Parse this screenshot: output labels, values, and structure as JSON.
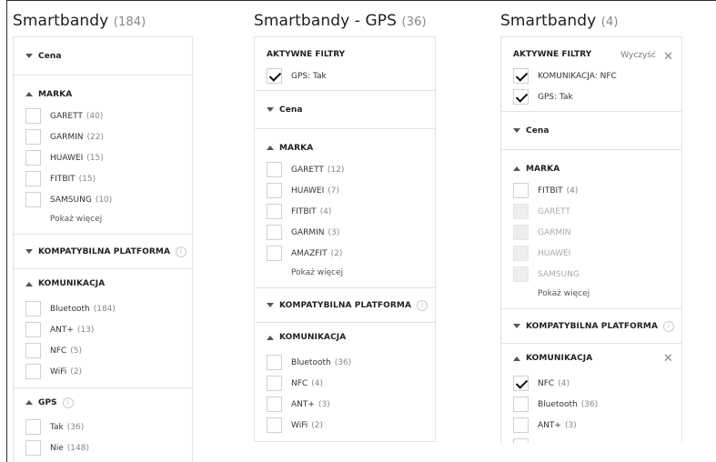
{
  "columns": [
    {
      "title": "Smartbandy",
      "count": "(184)",
      "sections": [
        {
          "label": "Cena",
          "expanded": false
        },
        {
          "label": "MARKA",
          "expanded": true,
          "options": [
            {
              "label": "GARETT",
              "count": "(40)"
            },
            {
              "label": "GARMIN",
              "count": "(22)"
            },
            {
              "label": "HUAWEI",
              "count": "(15)"
            },
            {
              "label": "FITBIT",
              "count": "(15)"
            },
            {
              "label": "SAMSUNG",
              "count": "(10)"
            }
          ],
          "more": "Pokaż więcej"
        },
        {
          "label": "KOMPATYBILNA PLATFORMA",
          "expanded": false,
          "info": true
        },
        {
          "label": "KOMUNIKACJA",
          "expanded": true,
          "options": [
            {
              "label": "Bluetooth",
              "count": "(184)"
            },
            {
              "label": "ANT+",
              "count": "(13)"
            },
            {
              "label": "NFC",
              "count": "(5)"
            },
            {
              "label": "WiFi",
              "count": "(2)"
            }
          ]
        },
        {
          "label": "GPS",
          "expanded": true,
          "info": true,
          "options": [
            {
              "label": "Tak",
              "count": "(36)"
            },
            {
              "label": "Nie",
              "count": "(148)"
            }
          ]
        }
      ]
    },
    {
      "title": "Smartbandy - GPS",
      "count": "(36)",
      "active": {
        "label": "AKTYWNE FILTRY",
        "items": [
          {
            "label": "GPS: Tak"
          }
        ]
      },
      "sections": [
        {
          "label": "Cena",
          "expanded": false
        },
        {
          "label": "MARKA",
          "expanded": true,
          "options": [
            {
              "label": "GARETT",
              "count": "(12)"
            },
            {
              "label": "HUAWEI",
              "count": "(7)"
            },
            {
              "label": "FITBIT",
              "count": "(4)"
            },
            {
              "label": "GARMIN",
              "count": "(3)"
            },
            {
              "label": "AMAZFIT",
              "count": "(2)"
            }
          ],
          "more": "Pokaż więcej"
        },
        {
          "label": "KOMPATYBILNA PLATFORMA",
          "expanded": false,
          "info": true
        },
        {
          "label": "KOMUNIKACJA",
          "expanded": true,
          "options": [
            {
              "label": "Bluetooth",
              "count": "(36)"
            },
            {
              "label": "NFC",
              "count": "(4)"
            },
            {
              "label": "ANT+",
              "count": "(3)"
            },
            {
              "label": "WiFi",
              "count": "(2)"
            }
          ]
        }
      ]
    },
    {
      "title": "Smartbandy",
      "count": "(4)",
      "active": {
        "label": "AKTYWNE FILTRY",
        "clear": "Wyczyść",
        "items": [
          {
            "label": "KOMUNIKACJA: NFC"
          },
          {
            "label": "GPS: Tak"
          }
        ]
      },
      "sections": [
        {
          "label": "Cena",
          "expanded": false
        },
        {
          "label": "MARKA",
          "expanded": true,
          "options": [
            {
              "label": "FITBIT",
              "count": "(4)"
            },
            {
              "label": "GARETT",
              "disabled": true
            },
            {
              "label": "GARMIN",
              "disabled": true
            },
            {
              "label": "HUAWEI",
              "disabled": true
            },
            {
              "label": "SAMSUNG",
              "disabled": true
            }
          ],
          "more": "Pokaż więcej"
        },
        {
          "label": "KOMPATYBILNA PLATFORMA",
          "expanded": false,
          "info": true
        },
        {
          "label": "KOMUNIKACJA",
          "expanded": true,
          "close": true,
          "options": [
            {
              "label": "NFC",
              "count": "(4)",
              "checked": true
            },
            {
              "label": "Bluetooth",
              "count": "(36)"
            },
            {
              "label": "ANT+",
              "count": "(3)"
            },
            {
              "label": "",
              "count": ""
            }
          ]
        }
      ]
    }
  ],
  "icons": {
    "info": "info-icon",
    "close": "close-icon",
    "checkbox": "checkbox",
    "caret-down": "chevron-down-icon",
    "caret-up": "chevron-up-icon"
  }
}
